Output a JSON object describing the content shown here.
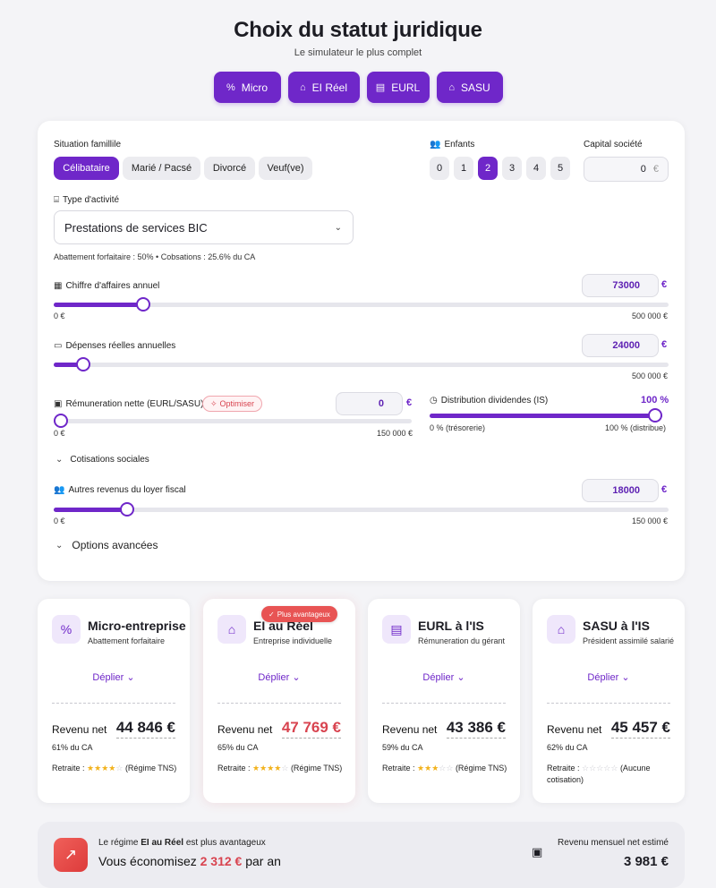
{
  "header": {
    "title": "Choix du statut juridique",
    "subtitle": "Le simulateur le plus complet"
  },
  "tabs": [
    {
      "label": "Micro",
      "icon": "percent-icon"
    },
    {
      "label": "EI Réel",
      "icon": "store-icon"
    },
    {
      "label": "EURL",
      "icon": "building-icon"
    },
    {
      "label": "SASU",
      "icon": "bank-icon"
    }
  ],
  "form": {
    "situation": {
      "label": "Situation famillile",
      "options": [
        "Célibataire",
        "Marié / Pacsé",
        "Divorcé",
        "Veuf(ve)"
      ],
      "selected": "Célibataire"
    },
    "enfants": {
      "label": "Enfants",
      "options": [
        "0",
        "1",
        "2",
        "3",
        "4",
        "5"
      ],
      "selected": "2"
    },
    "capital": {
      "label": "Capital société",
      "value": "0",
      "unit": "€"
    },
    "activite": {
      "label": "Type d'activité",
      "value": "Prestations de services BIC",
      "note": "Abattement forfaitaire : 50% • Cobsations : 25.6% du CA"
    },
    "ca": {
      "label": "Chiffre d'affaires annuel",
      "value": "73000",
      "unit": "€",
      "min_label": "0 €",
      "max_label": "500 000 €",
      "level": 0.146
    },
    "depenses": {
      "label": "Dépenses réelles annuelles",
      "value": "24000",
      "unit": "€",
      "min_label": "0 €",
      "max_label": "500 000 €",
      "level": 0.048
    },
    "remuneration": {
      "label": "Rémuneration nette (EURL/SASU)",
      "optimize_label": "Optimiser",
      "value": "0",
      "unit": "€",
      "min_label": "0 €",
      "max_label": "150 000 €",
      "level": 0
    },
    "dividendes": {
      "label": "Distribution dividendes (IS)",
      "value": "100 %",
      "min_label": "0 % (trésorerie)",
      "max_label": "100 % (distribue)",
      "level": 1
    },
    "cotisations_label": "Cotisations sociales",
    "autres": {
      "label": "Autres revenus du loyer fiscal",
      "value": "18000",
      "unit": "€",
      "min_label": "0 €",
      "max_label": "150 000 €",
      "level": 0.12
    },
    "options_label": "Options avancées"
  },
  "cards": [
    {
      "title": "Micro-entreprise",
      "subtitle": "Abattement forfaitaire",
      "icon": "percent-icon",
      "deplier": "Déplier",
      "revenu_label": "Revenu net",
      "revenu": "44 846 €",
      "pct": "61% du CA",
      "retraite_label": "Retraite :",
      "stars": 4,
      "retraite_note": "(Régime TNS)"
    },
    {
      "title": "EI au Réel",
      "subtitle": "Entreprise individuelle",
      "icon": "store-icon",
      "deplier": "Déplier",
      "revenu_label": "Revenu net",
      "revenu": "47 769 €",
      "pct": "65% du CA",
      "retraite_label": "Retraite :",
      "stars": 4,
      "retraite_note": "(Régime TNS)",
      "badge": "Plus avantageux"
    },
    {
      "title": "EURL à l'IS",
      "subtitle": "Rémuneration du gérant",
      "icon": "building-icon",
      "deplier": "Déplier",
      "revenu_label": "Revenu net",
      "revenu": "43 386 €",
      "pct": "59% du CA",
      "retraite_label": "Retraite :",
      "stars": 3,
      "retraite_note": "(Régime TNS)"
    },
    {
      "title": "SASU à l'IS",
      "subtitle": "Président assimilé salarié",
      "icon": "bank-icon",
      "deplier": "Déplier",
      "revenu_label": "Revenu net",
      "revenu": "45 457 €",
      "pct": "62% du CA",
      "retraite_label": "Retraite :",
      "stars": 0,
      "retraite_note": "(Aucune cotisation)"
    }
  ],
  "summary": {
    "line1_pre": "Le régime",
    "line1_bold": "EI au Réel",
    "line1_post": "est plus avantageux",
    "line2_pre": "Vous économisez",
    "line2_value": "2 312 €",
    "line2_post": "par an",
    "monthly_label": "Revenu mensuel net estimé",
    "monthly_value": "3 981 €"
  },
  "colors": {
    "accent": "#6f27c9",
    "highlight": "#d8434f",
    "star": "#f2b21c"
  }
}
